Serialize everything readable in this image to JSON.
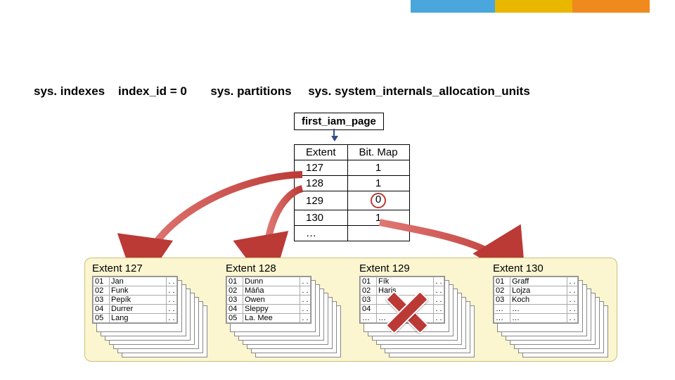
{
  "colors": {
    "topBlue": "#4aa6dc",
    "topYellow": "#e9b600",
    "topOrange": "#f08a1e",
    "accentRed": "#bb3a36",
    "panel": "#fbf5d0"
  },
  "heading": {
    "sys_indexes": "sys. indexes",
    "index_id": "index_id = 0",
    "sys_partitions": "sys. partitions",
    "sys_alloc": "sys. system_internals_allocation_units"
  },
  "iam_label": "first_iam_page",
  "iam_table": {
    "header": {
      "col1": "Extent",
      "col2": "Bit. Map"
    },
    "rows": [
      {
        "extent": "127",
        "bit": "1"
      },
      {
        "extent": "128",
        "bit": "1"
      },
      {
        "extent": "129",
        "bit": "0",
        "circled": true
      },
      {
        "extent": "130",
        "bit": "1"
      }
    ],
    "ellipsis": "…"
  },
  "extents": [
    {
      "label": "Extent 127",
      "rows": [
        {
          "n": "01",
          "name": "Jan",
          "d": ". ."
        },
        {
          "n": "02",
          "name": "Funk",
          "d": ". ."
        },
        {
          "n": "03",
          "name": "Pepík",
          "d": ". ."
        },
        {
          "n": "04",
          "name": "Durrer",
          "d": ". ."
        },
        {
          "n": "05",
          "name": "Lang",
          "d": ". ."
        }
      ]
    },
    {
      "label": "Extent 128",
      "rows": [
        {
          "n": "01",
          "name": "Dunn",
          "d": ". ."
        },
        {
          "n": "02",
          "name": "Máňa",
          "d": ". ."
        },
        {
          "n": "03",
          "name": "Owen",
          "d": ". ."
        },
        {
          "n": "04",
          "name": "Sleppy",
          "d": ". ."
        },
        {
          "n": "05",
          "name": "La. Mee",
          "d": ". ."
        }
      ]
    },
    {
      "label": "Extent 129",
      "crossed": true,
      "rows": [
        {
          "n": "01",
          "name": "Fík",
          "d": ". ."
        },
        {
          "n": "02",
          "name": "Haris",
          "d": ". ."
        },
        {
          "n": "03",
          "name": "",
          "d": ". ."
        },
        {
          "n": "04",
          "name": "",
          "d": ". ."
        },
        {
          "n": "…",
          "name": "…",
          "d": ". ."
        }
      ]
    },
    {
      "label": "Extent 130",
      "rows": [
        {
          "n": "01",
          "name": "Graff",
          "d": ". ."
        },
        {
          "n": "02",
          "name": "Lojza",
          "d": ". ."
        },
        {
          "n": "03",
          "name": "Koch",
          "d": ". ."
        },
        {
          "n": "…",
          "name": "…",
          "d": ". ."
        },
        {
          "n": "…",
          "name": "…",
          "d": ". ."
        }
      ]
    }
  ]
}
